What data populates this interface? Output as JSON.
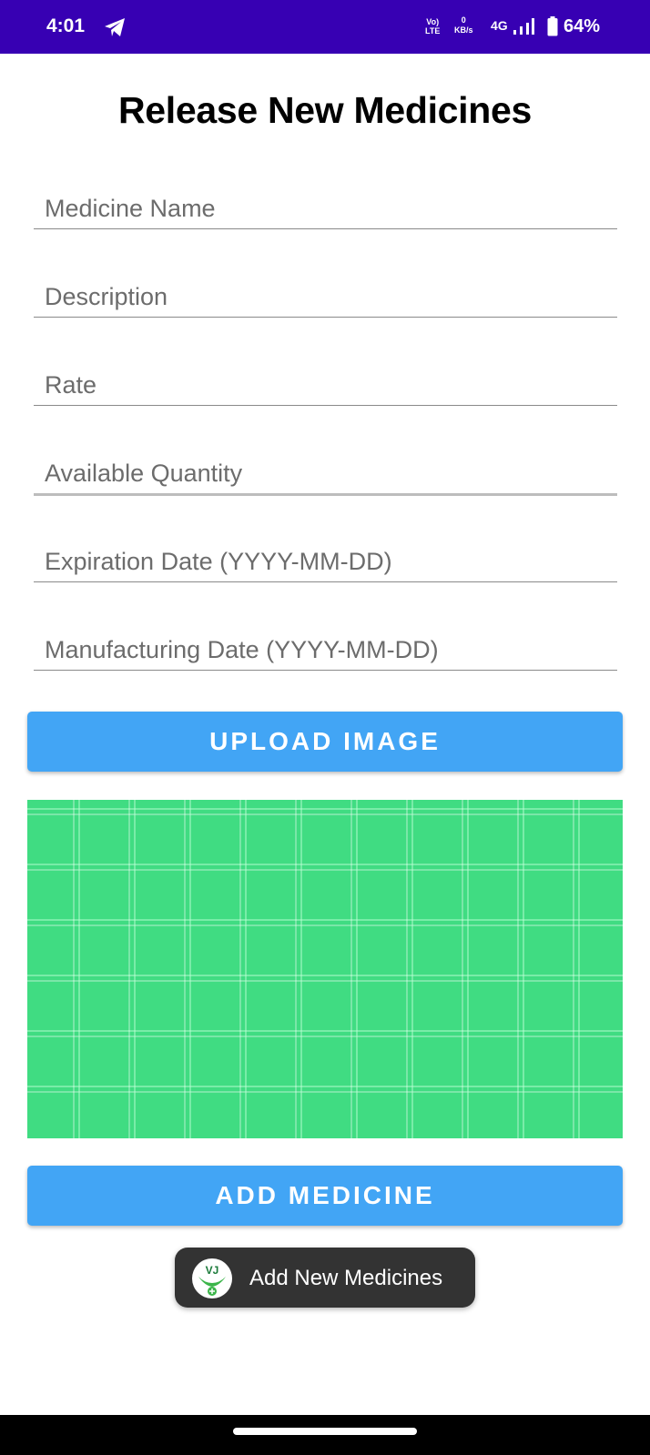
{
  "status_bar": {
    "time": "4:01",
    "volte_top": "Vo)",
    "volte_bottom": "LTE",
    "data_rate_value": "0",
    "data_rate_unit": "KB/s",
    "network": "4G",
    "battery": "64%",
    "icons": [
      "telegram-icon",
      "signal-icon",
      "battery-icon"
    ],
    "background": "#3700b3"
  },
  "page": {
    "title": "Release New Medicines"
  },
  "form": {
    "medicine_name": {
      "placeholder": "Medicine Name",
      "value": ""
    },
    "description": {
      "placeholder": "Description",
      "value": ""
    },
    "rate": {
      "placeholder": "Rate",
      "value": ""
    },
    "available_quantity": {
      "placeholder": "Available Quantity",
      "value": ""
    },
    "expiration_date": {
      "placeholder": "Expiration Date (YYYY-MM-DD)",
      "value": ""
    },
    "manufacturing_date": {
      "placeholder": "Manufacturing Date (YYYY-MM-DD)",
      "value": ""
    }
  },
  "buttons": {
    "upload_image": "UPLOAD IMAGE",
    "add_medicine": "ADD MEDICINE",
    "color": "#42a5f5"
  },
  "image_preview": {
    "color": "#40dc82",
    "pattern": "grid"
  },
  "toast": {
    "app_icon_text": "VJ",
    "message": "Add New Medicines"
  }
}
